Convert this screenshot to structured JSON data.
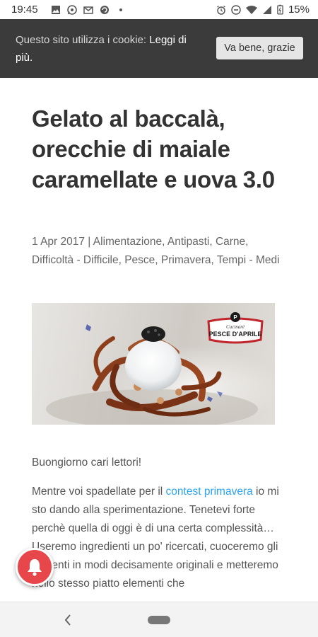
{
  "status_bar": {
    "time": "19:45",
    "left_icons": [
      "image-icon",
      "whatsapp-icon",
      "gmail-icon",
      "refresh-icon",
      "dot-icon"
    ],
    "right_icons": [
      "alarm-icon",
      "dnd-icon",
      "wifi-icon",
      "signal-icon",
      "battery-icon"
    ],
    "battery": "15%"
  },
  "cookie_banner": {
    "text": "Questo sito utilizza i cookie: ",
    "link": "Leggi di più.",
    "button": "Va bene, grazie",
    "background": "#3b3b3b"
  },
  "article": {
    "title": "Gelato al baccalà, orecchie di maiale caramellate e uova 3.0",
    "date": "1 Apr 2017",
    "separator": " | ",
    "categories": "Alimentazione, Antipasti, Carne, Difficoltà - Difficile, Pesce, Primavera, Tempi - Medi",
    "image_logo": {
      "top": "Cucinaré",
      "main": "PESCE D'APRILE",
      "letter": "P"
    },
    "greeting": "Buongiorno cari lettori!",
    "paragraph_start": "Mentre voi spadellate per il ",
    "paragraph_link": "contest primavera",
    "paragraph_rest": " io mi sto dando alla sperimentazione. Tenetevi forte perchè quella di oggi è di una certa complessità… Useremo ingredienti un po' ricercati, cuoceremo gli alimenti in modi decisamente originali e metteremo nello stesso piatto elementi che",
    "link_color": "#2ea3f2"
  },
  "notification_bell": {
    "icon": "bell-icon",
    "color": "#e7464a"
  },
  "nav_bar": {
    "back_icon": "chevron-left-icon",
    "home_icon": "home-pill-icon"
  }
}
